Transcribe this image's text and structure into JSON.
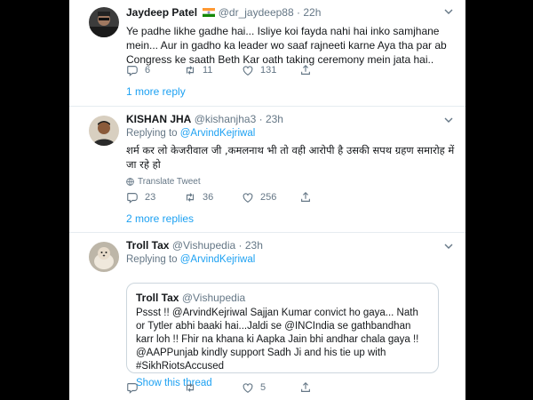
{
  "tweets": [
    {
      "name": "Jaydeep Patel",
      "flag_icon": "india-flag-icon",
      "handle": "@dr_jaydeep88",
      "dot": "·",
      "time": "22h",
      "text": "Ye padhe likhe gadhe hai... Isliye koi fayda nahi hai inko samjhane mein... Aur in gadho ka leader wo saaf rajneeti karne Aya tha par ab Congress ke saath Beth Kar oath taking ceremony mein jata hai..",
      "replies": "6",
      "retweets": "11",
      "likes": "131",
      "more_replies": "1 more reply"
    },
    {
      "name": "KISHAN JHA",
      "handle": "@kishanjha3",
      "dot": "·",
      "time": "23h",
      "replying_label": "Replying to",
      "replying_to": "@ArvindKejriwal",
      "text": "शर्म कर लो केजरीवाल जी ,कमलनाथ भी तो वही आरोपी है उसकी सपथ ग्रहण समारोह में जा रहे हो",
      "translate": "Translate Tweet",
      "replies": "23",
      "retweets": "36",
      "likes": "256",
      "more_replies": "2 more replies"
    },
    {
      "name": "Troll Tax",
      "handle": "@Vishupedia",
      "dot": "·",
      "time": "23h",
      "replying_label": "Replying to",
      "replying_to": "@ArvindKejriwal",
      "quote": {
        "name": "Troll Tax",
        "handle": "@Vishupedia",
        "text": "Pssst !! @ArvindKejriwal Sajjan Kumar convict ho gaya... Nath or Tytler abhi baaki hai...Jaldi se @INCIndia se gathbandhan karr loh !! Fhir na khana ki Aapka Jain bhi andhar chala gaya !!  @AAPPunjab kindly support Sadh Ji and his tie up with #SikhRiotsAccused",
        "show_thread": "Show this thread"
      },
      "replies": "",
      "retweets": "",
      "likes": "5"
    }
  ],
  "colors": {
    "link": "#1da1f2",
    "secondary": "#657786",
    "border": "#e6ecf0",
    "background": "#000000"
  }
}
